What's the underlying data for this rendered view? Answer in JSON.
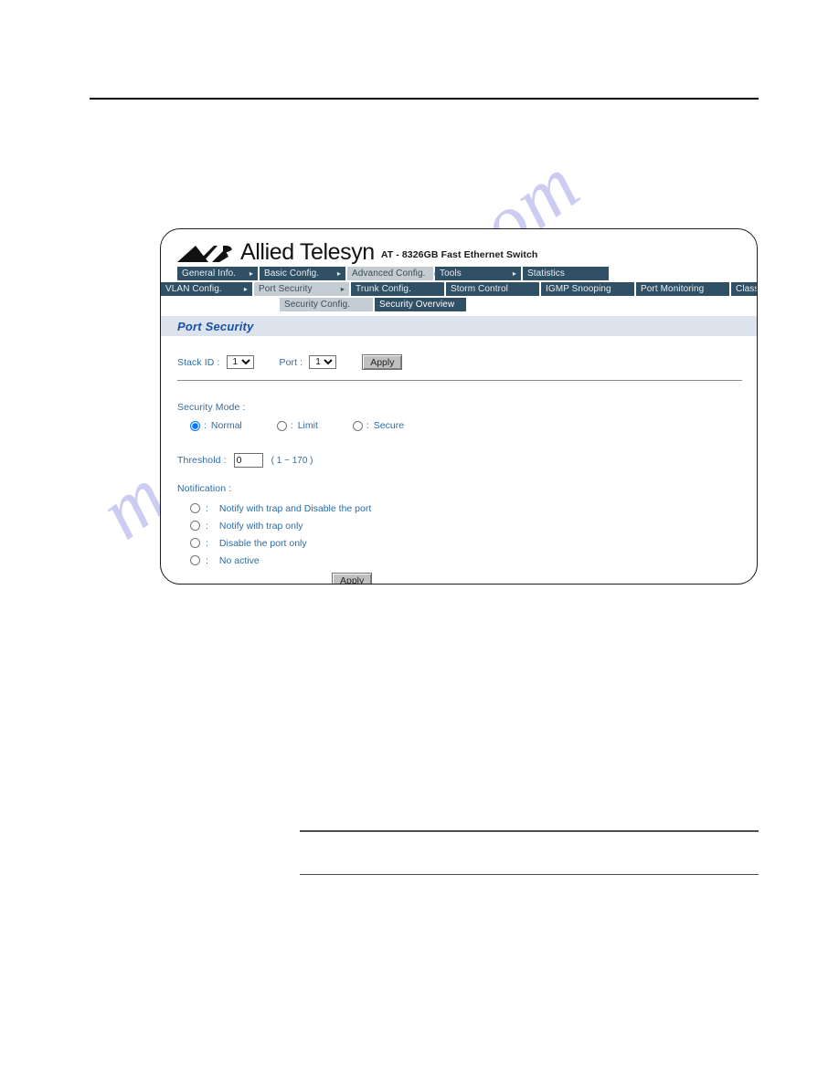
{
  "watermark": {
    "text": "manualshive.com"
  },
  "device": {
    "brand": "Allied Telesyn",
    "model": "AT - 8326GB Fast Ethernet Switch",
    "logo_icon": "allied-telesyn-arrow-logo"
  },
  "menu": {
    "row1": [
      {
        "label": "General Info.",
        "state": "normal",
        "arrow": "▸"
      },
      {
        "label": "Basic Config.",
        "state": "normal",
        "arrow": "▸"
      },
      {
        "label": "Advanced Config.",
        "state": "highlight",
        "arrow": "▸"
      },
      {
        "label": "Tools",
        "state": "normal",
        "arrow": "▸"
      },
      {
        "label": "Statistics",
        "state": "normal",
        "arrow": ""
      }
    ],
    "row2": [
      {
        "label": "VLAN Config.",
        "state": "normal",
        "arrow": "▸"
      },
      {
        "label": "Port Security",
        "state": "highlight",
        "arrow": "▸"
      },
      {
        "label": "Trunk Config.",
        "state": "normal",
        "arrow": ""
      },
      {
        "label": "Storm Control",
        "state": "normal",
        "arrow": ""
      },
      {
        "label": "IGMP Snooping",
        "state": "normal",
        "arrow": ""
      },
      {
        "label": "Port Monitoring",
        "state": "normal",
        "arrow": ""
      },
      {
        "label": "Class of S",
        "state": "normal",
        "arrow": ""
      }
    ],
    "row3": [
      {
        "label": "Security Config.",
        "state": "highlight",
        "arrow": ""
      },
      {
        "label": "Security Overview",
        "state": "selected",
        "arrow": ""
      }
    ]
  },
  "page": {
    "title": "Port Security"
  },
  "form": {
    "stack_id_label": "Stack ID :",
    "stack_id_value": "1",
    "port_label": "Port :",
    "port_value": "1",
    "apply_top_label": "Apply",
    "apply_bottom_label": "Apply",
    "security_mode_label": "Security Mode :",
    "security_mode_options": [
      {
        "label": "Normal",
        "selected": true
      },
      {
        "label": "Limit",
        "selected": false
      },
      {
        "label": "Secure",
        "selected": false
      }
    ],
    "threshold_label": "Threshold :",
    "threshold_value": "0",
    "threshold_hint": "( 1 ~ 170 )",
    "notification_label": "Notification :",
    "notification_options": [
      {
        "label": "Notify with trap and Disable the port",
        "selected": false
      },
      {
        "label": "Notify with trap only",
        "selected": false
      },
      {
        "label": "Disable the port only",
        "selected": false
      },
      {
        "label": "No active",
        "selected": false
      }
    ],
    "separator": ":"
  },
  "colors": {
    "menu_bg": "#2f5065",
    "menu_highlight": "#c3ccd2",
    "title_band": "#dde3ec",
    "title_text": "#1b4fa8",
    "label_text": "#2d6da3",
    "watermark": "#ccccf2"
  }
}
